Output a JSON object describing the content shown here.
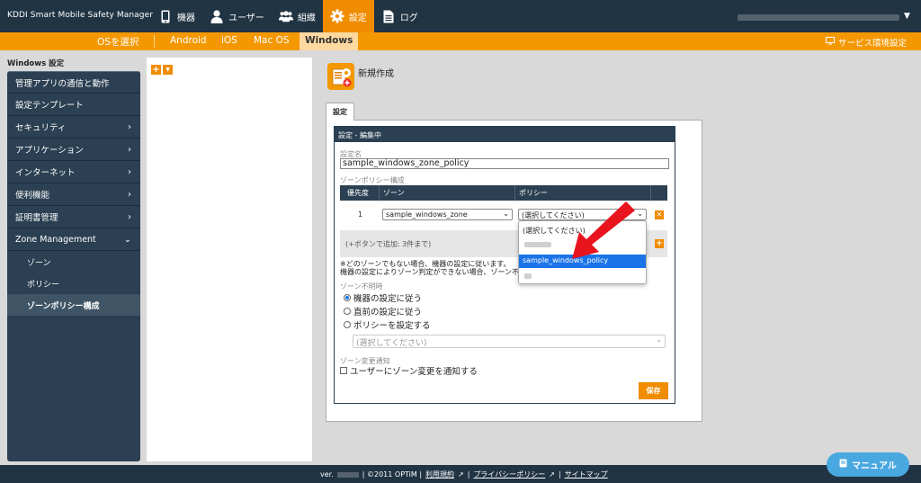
{
  "app": {
    "title": "KDDI Smart Mobile Safety Manager"
  },
  "nav": [
    {
      "label": "機器",
      "icon": "phone-icon"
    },
    {
      "label": "ユーザー",
      "icon": "user-icon"
    },
    {
      "label": "組織",
      "icon": "group-icon"
    },
    {
      "label": "設定",
      "icon": "gear-icon",
      "active": true
    },
    {
      "label": "ログ",
      "icon": "document-icon"
    }
  ],
  "osbar": {
    "select_label": "OSを選択",
    "tabs": [
      "Android",
      "iOS",
      "Mac OS",
      "Windows"
    ],
    "active_tab": "Windows",
    "service_settings": "サービス環境設定"
  },
  "sidebar": {
    "title": "Windows 設定",
    "items": [
      {
        "label": "管理アプリの通信と動作",
        "chevron": ""
      },
      {
        "label": "設定テンプレート",
        "chevron": ""
      },
      {
        "label": "セキュリティ",
        "chevron": "›"
      },
      {
        "label": "アプリケーション",
        "chevron": "›"
      },
      {
        "label": "インターネット",
        "chevron": "›"
      },
      {
        "label": "便利機能",
        "chevron": "›"
      },
      {
        "label": "証明書管理",
        "chevron": "›"
      },
      {
        "label": "Zone Management",
        "chevron": "⌄"
      }
    ],
    "sub_items": [
      "ゾーン",
      "ポリシー",
      "ゾーンポリシー構成"
    ],
    "active_sub": "ゾーンポリシー構成"
  },
  "tree": {
    "add": "+",
    "menu": "▼"
  },
  "main": {
    "title": "新規作成",
    "tab": "設定",
    "panel_header": "設定 - 編集中",
    "name_label": "設定名",
    "name_value": "sample_windows_zone_policy",
    "config_label": "ゾーンポリシー構成",
    "table": {
      "headers": [
        "優先度",
        "ゾーン",
        "ポリシー"
      ],
      "row": {
        "priority": "1",
        "zone": "sample_windows_zone",
        "policy": "(選択してください)"
      }
    },
    "add_hint": "(+ボタンで追加: 3件まで)",
    "note_line1": "※どのゾーンでもない場合、機器の設定に従います。",
    "note_line2": "機器の設定によりゾーン判定ができない場合、ゾーン不",
    "unknown_label": "ゾーン不明時",
    "radio": [
      {
        "label": "機器の設定に従う",
        "checked": true
      },
      {
        "label": "直前の設定に従う",
        "checked": false
      },
      {
        "label": "ポリシーを設定する",
        "checked": false
      }
    ],
    "policy_select": "(選択してください)",
    "notify_label": "ゾーン変更通知",
    "notify_checkbox": "ユーザーにゾーン変更を通知する",
    "save": "保存"
  },
  "dropdown": {
    "options": [
      "(選択してください)",
      "sample_windows_policy"
    ],
    "selected": "sample_windows_policy"
  },
  "footer": {
    "ver_prefix": "ver.",
    "copyright": "| ©2011 OPTiM |",
    "terms": "利用規約",
    "privacy": "プライバシーポリシー",
    "sitemap": "サイトマップ",
    "sep": "|"
  },
  "manual": {
    "label": "マニュアル"
  },
  "colors": {
    "navy": "#213444",
    "orange": "#f39800",
    "accent_blue": "#1a73e8",
    "manual_blue": "#49a8e0"
  }
}
